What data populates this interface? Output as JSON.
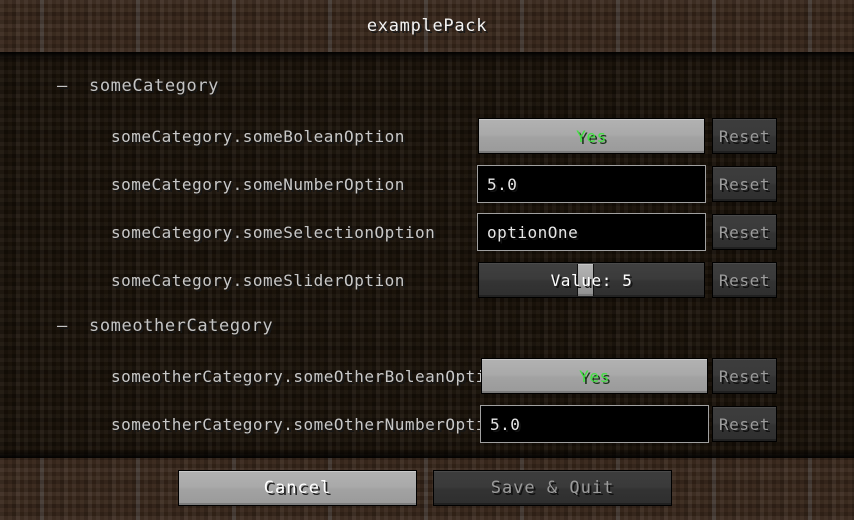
{
  "window": {
    "title": "examplePack"
  },
  "categories": [
    {
      "name": "someCategory",
      "collapse_icon": "–",
      "options": [
        {
          "label": "someCategory.someBoleanOption",
          "type": "boolean",
          "value": "Yes",
          "reset_label": "Reset"
        },
        {
          "label": "someCategory.someNumberOption",
          "type": "number",
          "value": "5.0",
          "reset_label": "Reset"
        },
        {
          "label": "someCategory.someSelectionOption",
          "type": "selection",
          "value": "optionOne",
          "reset_label": "Reset"
        },
        {
          "label": "someCategory.someSliderOption",
          "type": "slider",
          "value": "Value: 5",
          "slider_percent": 47,
          "reset_label": "Reset"
        }
      ]
    },
    {
      "name": "someotherCategory",
      "collapse_icon": "–",
      "options": [
        {
          "label": "someotherCategory.someOtherBoleanOption",
          "type": "boolean",
          "value": "Yes",
          "reset_label": "Reset"
        },
        {
          "label": "someotherCategory.someOtherNumberOption",
          "type": "number",
          "value": "5.0",
          "reset_label": "Reset"
        }
      ]
    }
  ],
  "footer": {
    "cancel_label": "Cancel",
    "save_label": "Save & Quit"
  },
  "colors": {
    "accent_green": "#41e241",
    "text": "#d8d8d8",
    "dirt": "#362519",
    "dirt_dark": "#191108"
  }
}
